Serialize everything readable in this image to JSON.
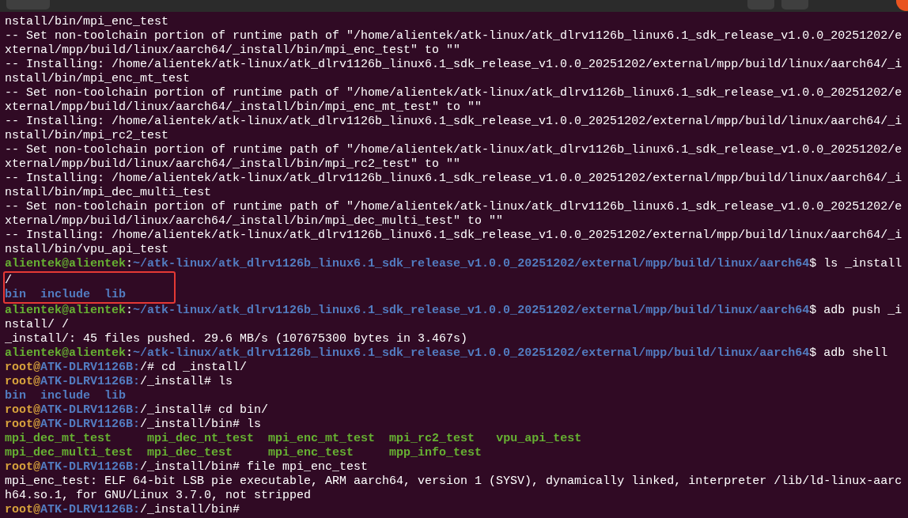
{
  "terminal": {
    "lines": [
      {
        "kind": "line",
        "segments": [
          {
            "kind": "plain",
            "text": "nstall/bin/mpi_enc_test"
          }
        ]
      },
      {
        "kind": "line",
        "segments": [
          {
            "kind": "plain",
            "text": "-- Set non-toolchain portion of runtime path of \"/home/alientek/atk-linux/atk_dlrv1126b_linux6.1_sdk_release_v1.0.0_20251202/e"
          }
        ]
      },
      {
        "kind": "line",
        "segments": [
          {
            "kind": "plain",
            "text": "xternal/mpp/build/linux/aarch64/_install/bin/mpi_enc_test\" to \"\""
          }
        ]
      },
      {
        "kind": "line",
        "segments": [
          {
            "kind": "plain",
            "text": "-- Installing: /home/alientek/atk-linux/atk_dlrv1126b_linux6.1_sdk_release_v1.0.0_20251202/external/mpp/build/linux/aarch64/_i"
          }
        ]
      },
      {
        "kind": "line",
        "segments": [
          {
            "kind": "plain",
            "text": "nstall/bin/mpi_enc_mt_test"
          }
        ]
      },
      {
        "kind": "line",
        "segments": [
          {
            "kind": "plain",
            "text": "-- Set non-toolchain portion of runtime path of \"/home/alientek/atk-linux/atk_dlrv1126b_linux6.1_sdk_release_v1.0.0_20251202/e"
          }
        ]
      },
      {
        "kind": "line",
        "segments": [
          {
            "kind": "plain",
            "text": "xternal/mpp/build/linux/aarch64/_install/bin/mpi_enc_mt_test\" to \"\""
          }
        ]
      },
      {
        "kind": "line",
        "segments": [
          {
            "kind": "plain",
            "text": "-- Installing: /home/alientek/atk-linux/atk_dlrv1126b_linux6.1_sdk_release_v1.0.0_20251202/external/mpp/build/linux/aarch64/_i"
          }
        ]
      },
      {
        "kind": "line",
        "segments": [
          {
            "kind": "plain",
            "text": "nstall/bin/mpi_rc2_test"
          }
        ]
      },
      {
        "kind": "line",
        "segments": [
          {
            "kind": "plain",
            "text": "-- Set non-toolchain portion of runtime path of \"/home/alientek/atk-linux/atk_dlrv1126b_linux6.1_sdk_release_v1.0.0_20251202/e"
          }
        ]
      },
      {
        "kind": "line",
        "segments": [
          {
            "kind": "plain",
            "text": "xternal/mpp/build/linux/aarch64/_install/bin/mpi_rc2_test\" to \"\""
          }
        ]
      },
      {
        "kind": "line",
        "segments": [
          {
            "kind": "plain",
            "text": "-- Installing: /home/alientek/atk-linux/atk_dlrv1126b_linux6.1_sdk_release_v1.0.0_20251202/external/mpp/build/linux/aarch64/_i"
          }
        ]
      },
      {
        "kind": "line",
        "segments": [
          {
            "kind": "plain",
            "text": "nstall/bin/mpi_dec_multi_test"
          }
        ]
      },
      {
        "kind": "line",
        "segments": [
          {
            "kind": "plain",
            "text": "-- Set non-toolchain portion of runtime path of \"/home/alientek/atk-linux/atk_dlrv1126b_linux6.1_sdk_release_v1.0.0_20251202/e"
          }
        ]
      },
      {
        "kind": "line",
        "segments": [
          {
            "kind": "plain",
            "text": "xternal/mpp/build/linux/aarch64/_install/bin/mpi_dec_multi_test\" to \"\""
          }
        ]
      },
      {
        "kind": "line",
        "segments": [
          {
            "kind": "plain",
            "text": "-- Installing: /home/alientek/atk-linux/atk_dlrv1126b_linux6.1_sdk_release_v1.0.0_20251202/external/mpp/build/linux/aarch64/_i"
          }
        ]
      },
      {
        "kind": "line",
        "segments": [
          {
            "kind": "plain",
            "text": "nstall/bin/vpu_api_test"
          }
        ]
      },
      {
        "kind": "line",
        "segments": [
          {
            "kind": "user",
            "text": "alientek@alientek"
          },
          {
            "kind": "plain",
            "text": ":"
          },
          {
            "kind": "path",
            "text": "~/atk-linux/atk_dlrv1126b_linux6.1_sdk_release_v1.0.0_20251202/external/mpp/build/linux/aarch64"
          },
          {
            "kind": "plain",
            "text": "$ ls _install"
          }
        ]
      },
      {
        "kind": "highlight",
        "lines": [
          {
            "kind": "line",
            "segments": [
              {
                "kind": "plain",
                "text": "/"
              }
            ]
          },
          {
            "kind": "listing",
            "rows": [
              [
                {
                  "name": "bin",
                  "kind": "directory"
                },
                {
                  "name": "include",
                  "kind": "directory"
                },
                {
                  "name": "lib",
                  "kind": "directory"
                }
              ]
            ]
          }
        ]
      },
      {
        "kind": "line",
        "segments": [
          {
            "kind": "user",
            "text": "alientek@alientek"
          },
          {
            "kind": "plain",
            "text": ":"
          },
          {
            "kind": "path",
            "text": "~/atk-linux/atk_dlrv1126b_linux6.1_sdk_release_v1.0.0_20251202/external/mpp/build/linux/aarch64"
          },
          {
            "kind": "plain",
            "text": "$ adb push _i"
          }
        ]
      },
      {
        "kind": "line",
        "segments": [
          {
            "kind": "plain",
            "text": "nstall/ /"
          }
        ]
      },
      {
        "kind": "line",
        "segments": [
          {
            "kind": "plain",
            "text": "_install/: 45 files pushed. 29.6 MB/s (107675300 bytes in 3.467s)"
          }
        ]
      },
      {
        "kind": "line",
        "segments": [
          {
            "kind": "user",
            "text": "alientek@alientek"
          },
          {
            "kind": "plain",
            "text": ":"
          },
          {
            "kind": "path",
            "text": "~/atk-linux/atk_dlrv1126b_linux6.1_sdk_release_v1.0.0_20251202/external/mpp/build/linux/aarch64"
          },
          {
            "kind": "plain",
            "text": "$ adb shell"
          }
        ]
      },
      {
        "kind": "line",
        "segments": [
          {
            "kind": "root",
            "text": "root@"
          },
          {
            "kind": "host",
            "text": "ATK-DLRV1126B:"
          },
          {
            "kind": "plain",
            "text": "/# cd _install/"
          }
        ]
      },
      {
        "kind": "line",
        "segments": [
          {
            "kind": "root",
            "text": "root@"
          },
          {
            "kind": "host",
            "text": "ATK-DLRV1126B:"
          },
          {
            "kind": "plain",
            "text": "/_install# ls"
          }
        ]
      },
      {
        "kind": "listing",
        "rows": [
          [
            {
              "name": "bin",
              "kind": "directory"
            },
            {
              "name": "include",
              "kind": "directory"
            },
            {
              "name": "lib",
              "kind": "directory"
            }
          ]
        ]
      },
      {
        "kind": "line",
        "segments": [
          {
            "kind": "root",
            "text": "root@"
          },
          {
            "kind": "host",
            "text": "ATK-DLRV1126B:"
          },
          {
            "kind": "plain",
            "text": "/_install# cd bin/"
          }
        ]
      },
      {
        "kind": "line",
        "segments": [
          {
            "kind": "root",
            "text": "root@"
          },
          {
            "kind": "host",
            "text": "ATK-DLRV1126B:"
          },
          {
            "kind": "plain",
            "text": "/_install/bin# ls"
          }
        ]
      },
      {
        "kind": "listing",
        "rows": [
          [
            {
              "name": "mpi_dec_mt_test",
              "kind": "executable"
            },
            {
              "name": "mpi_dec_nt_test",
              "kind": "executable"
            },
            {
              "name": "mpi_enc_mt_test",
              "kind": "executable"
            },
            {
              "name": "mpi_rc2_test",
              "kind": "executable"
            },
            {
              "name": "vpu_api_test",
              "kind": "executable"
            }
          ],
          [
            {
              "name": "mpi_dec_multi_test",
              "kind": "executable"
            },
            {
              "name": "mpi_dec_test",
              "kind": "executable"
            },
            {
              "name": "mpi_enc_test",
              "kind": "executable"
            },
            {
              "name": "mpp_info_test",
              "kind": "executable"
            }
          ]
        ]
      },
      {
        "kind": "line",
        "segments": [
          {
            "kind": "root",
            "text": "root@"
          },
          {
            "kind": "host",
            "text": "ATK-DLRV1126B:"
          },
          {
            "kind": "plain",
            "text": "/_install/bin# file mpi_enc_test"
          }
        ]
      },
      {
        "kind": "line",
        "segments": [
          {
            "kind": "plain",
            "text": "mpi_enc_test: ELF 64-bit LSB pie executable, ARM aarch64, version 1 (SYSV), dynamically linked, interpreter /lib/ld-linux-aarc"
          }
        ]
      },
      {
        "kind": "line",
        "segments": [
          {
            "kind": "plain",
            "text": "h64.so.1, for GNU/Linux 3.7.0, not stripped"
          }
        ]
      },
      {
        "kind": "line",
        "segments": [
          {
            "kind": "root",
            "text": "root@"
          },
          {
            "kind": "host",
            "text": "ATK-DLRV1126B:"
          },
          {
            "kind": "plain",
            "text": "/_install/bin#"
          }
        ]
      }
    ]
  }
}
